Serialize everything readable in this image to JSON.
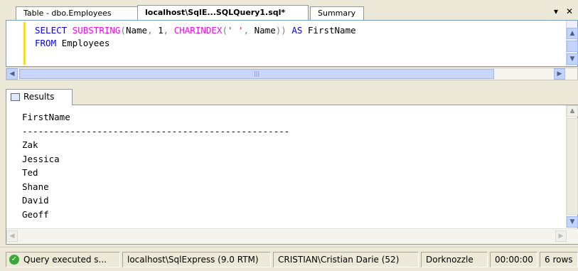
{
  "tabs": [
    {
      "label": "Table - dbo.Employees"
    },
    {
      "label": "localhost\\SqlE...SQLQuery1.sql*"
    },
    {
      "label": "Summary"
    }
  ],
  "tab_controls": {
    "dropdown": "▾",
    "close": "✕"
  },
  "query": {
    "line1": {
      "select": "SELECT",
      "substring": "SUBSTRING",
      "p1": "(",
      "name1": "Name",
      "c1": ",",
      "one": " 1",
      "c2": ",",
      "charindex": " CHARINDEX",
      "p2": "(",
      "str": "' '",
      "c3": ",",
      "name2": " Name",
      "p3": "))",
      "as": " AS",
      "alias": " FirstName"
    },
    "line2": {
      "from": "FROM",
      "table": " Employees"
    }
  },
  "results_tab": {
    "label": "Results"
  },
  "results": {
    "header": "FirstName",
    "separator": "--------------------------------------------------",
    "rows": [
      "Zak",
      "Jessica",
      "Ted",
      "Shane",
      "David",
      "Geoff"
    ]
  },
  "status": {
    "message": "Query executed s...",
    "server": "localhost\\SqlExpress (9.0 RTM)",
    "user": "CRISTIAN\\Cristian Darie (52)",
    "database": "Dorknozzle",
    "elapsed": "00:00:00",
    "rows": "6 rows"
  }
}
